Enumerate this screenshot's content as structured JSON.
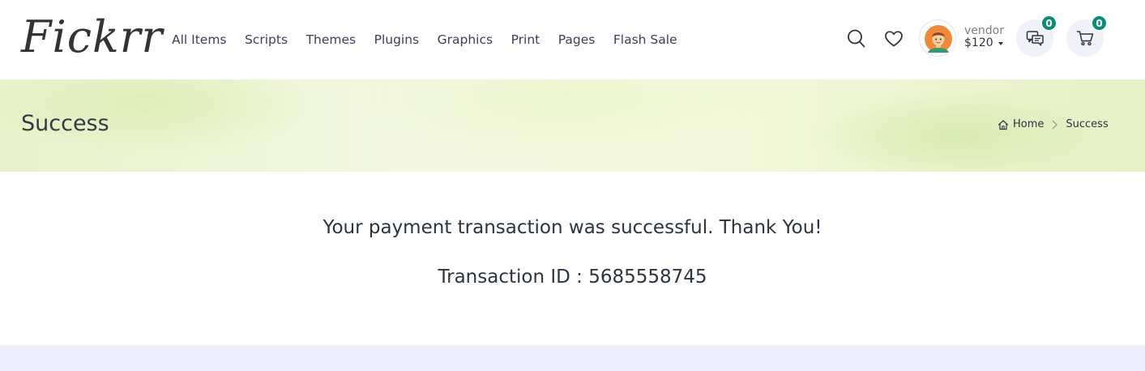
{
  "brand": {
    "logo_text": "Fickrr"
  },
  "nav": {
    "items": [
      {
        "label": "All Items"
      },
      {
        "label": "Scripts"
      },
      {
        "label": "Themes"
      },
      {
        "label": "Plugins"
      },
      {
        "label": "Graphics"
      },
      {
        "label": "Print"
      },
      {
        "label": "Pages"
      },
      {
        "label": "Flash Sale"
      }
    ]
  },
  "header_actions": {
    "search_icon": "search-icon",
    "wishlist_icon": "heart-icon",
    "user": {
      "name": "vendor",
      "balance": "$120"
    },
    "messages": {
      "icon": "chat-icon",
      "count": "0"
    },
    "cart": {
      "icon": "cart-icon",
      "count": "0"
    },
    "badge_color": "#0d8a78"
  },
  "banner": {
    "title": "Success",
    "breadcrumb": {
      "home": "Home",
      "current": "Success"
    }
  },
  "content": {
    "message": "Your payment transaction was successful. Thank You!",
    "transaction_line": "Transaction ID : 5685558745"
  }
}
